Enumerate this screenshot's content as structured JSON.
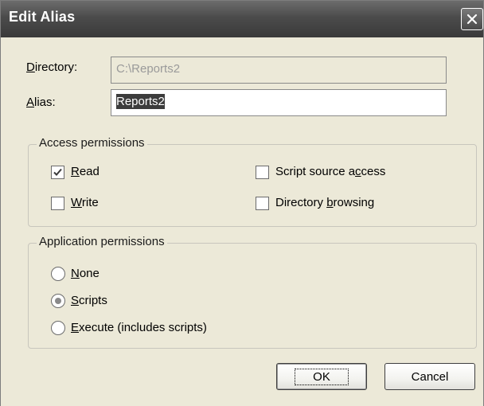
{
  "dialog": {
    "title": "Edit Alias",
    "close_icon": "close-icon"
  },
  "fields": {
    "directory": {
      "label_accel": "D",
      "label_rest": "irectory:",
      "value": "C:\\Reports2",
      "disabled": true
    },
    "alias": {
      "label_accel": "A",
      "label_rest": "lias:",
      "value": "Reports2",
      "selected": true
    }
  },
  "access_permissions": {
    "title": "Access permissions",
    "read": {
      "accel": "R",
      "rest": "ead",
      "checked": true
    },
    "write": {
      "accel": "W",
      "rest": "rite",
      "checked": false
    },
    "script_source": {
      "pre": "Script source a",
      "accel": "c",
      "post": "cess",
      "checked": false
    },
    "directory_browsing": {
      "pre": "Directory ",
      "accel": "b",
      "post": "rowsing",
      "checked": false
    }
  },
  "application_permissions": {
    "title": "Application permissions",
    "options": [
      {
        "accel": "N",
        "rest": "one",
        "selected": false
      },
      {
        "accel": "S",
        "rest": "cripts",
        "selected": true
      },
      {
        "accel": "E",
        "rest": "xecute (includes scripts)",
        "selected": false
      }
    ]
  },
  "buttons": {
    "ok_label": "OK",
    "cancel_label": "Cancel"
  }
}
